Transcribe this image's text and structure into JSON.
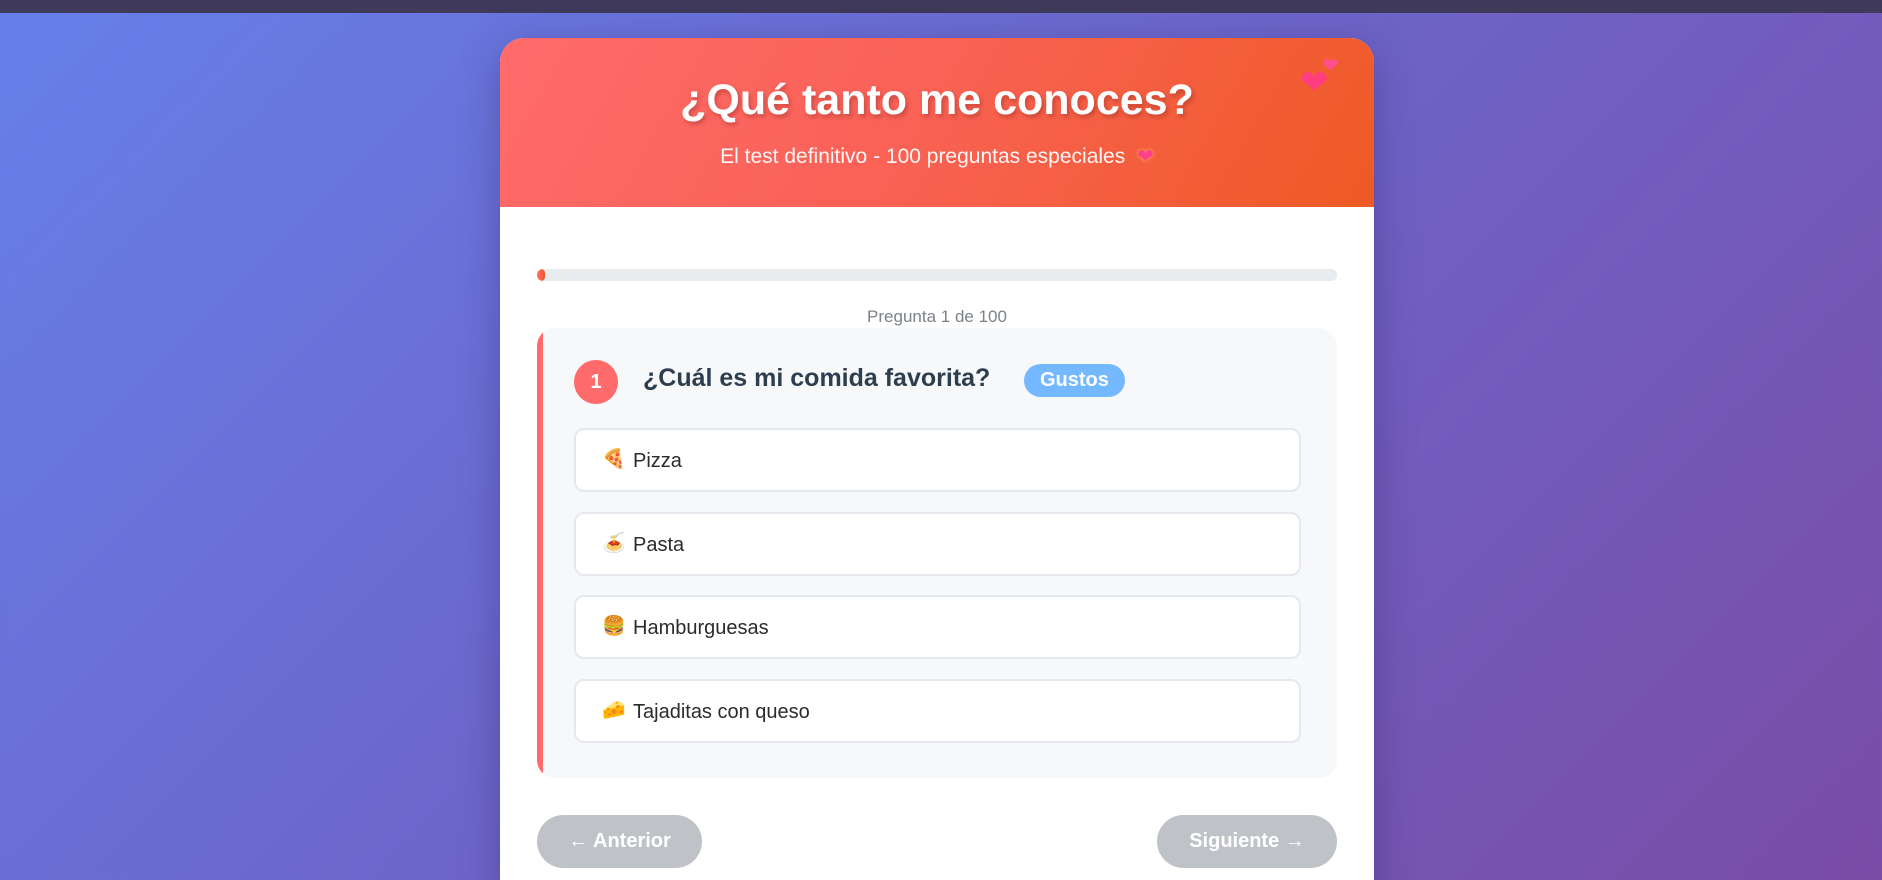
{
  "header": {
    "title": "¿Qué tanto me conoces?",
    "subtitle": "El test definitivo - 100 preguntas especiales",
    "subtitle_icon": "sparkling-heart-icon",
    "decoration_icon": "two-hearts-icon"
  },
  "progress": {
    "current": 1,
    "total": 100,
    "fraction": 0.01,
    "text": "Pregunta 1 de 100"
  },
  "question": {
    "number": "1",
    "text": "¿Cuál es mi comida favorita?",
    "category": "Gustos",
    "options": [
      {
        "emoji": "🍕",
        "icon": "pizza-icon",
        "label": "Pizza"
      },
      {
        "emoji": "🍝",
        "icon": "spaghetti-icon",
        "label": "Pasta"
      },
      {
        "emoji": "🍔",
        "icon": "hamburger-icon",
        "label": "Hamburguesas"
      },
      {
        "emoji": "🧀",
        "icon": "cheese-icon",
        "label": "Tajaditas con queso"
      }
    ]
  },
  "nav": {
    "prev_label": "← Anterior",
    "next_label": "Siguiente →"
  },
  "colors": {
    "accent": "#ff6b6b",
    "accent_dark": "#ee5a24",
    "category_badge": "#74b9ff",
    "disabled_button": "#bfc3c7",
    "question_text": "#2d3e4f"
  }
}
